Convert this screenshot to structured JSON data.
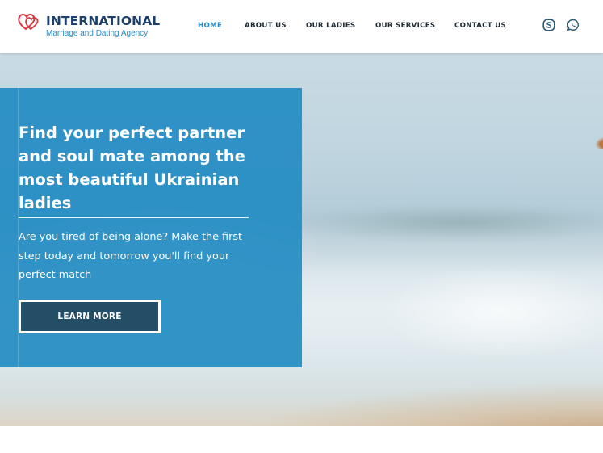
{
  "header": {
    "logo": {
      "title": "INTERNATIONAL",
      "subtitle": "Marriage and Dating Agency",
      "icon": "hearts-icon",
      "colors": {
        "title": "#1c3f6b",
        "subtitle": "#2a8bc0",
        "heart_red": "#d9363e",
        "heart_blue": "#2a8bc0"
      }
    },
    "nav": [
      {
        "label": "HOME",
        "active": true
      },
      {
        "label": "ABOUT US",
        "active": false
      },
      {
        "label": "OUR LADIES",
        "active": false
      },
      {
        "label": "OUR SERVICES",
        "active": false
      },
      {
        "label": "CONTACT US",
        "active": false
      }
    ],
    "social": [
      {
        "icon": "skype-icon"
      },
      {
        "icon": "whatsapp-icon"
      }
    ]
  },
  "hero": {
    "heading": "Find your perfect partner and soul mate among the most beautiful Ukrainian ladies",
    "text": "Are you tired of being alone? Make the first step today and tomorrow you'll find your perfect match",
    "button_label": "LEARN MORE",
    "colors": {
      "panel": "#238cc3",
      "button": "#234e66",
      "accent": "#2a8bc0"
    }
  }
}
